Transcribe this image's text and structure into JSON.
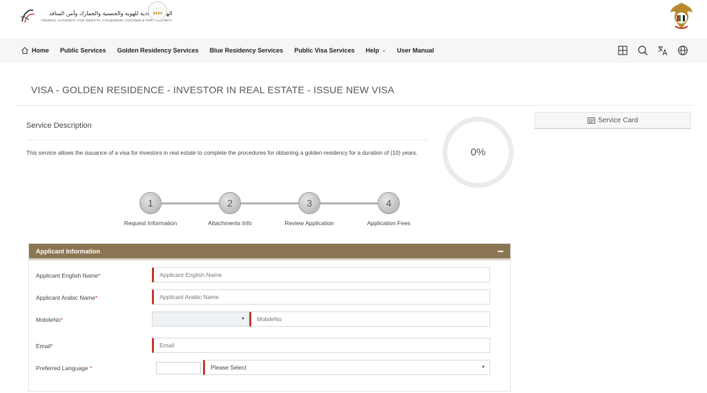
{
  "header": {
    "authority_ar": "الهيئة الاتحادية للهوية والجنسية والجمارك وأمن المنافذ",
    "authority_en": "FEDERAL AUTHORITY FOR IDENTITY, CITIZENSHIP, CUSTOMS & PORT SECURITY"
  },
  "nav": {
    "items": [
      {
        "label": "Home",
        "icon": "home-icon"
      },
      {
        "label": "Public Services"
      },
      {
        "label": "Golden Residency Services"
      },
      {
        "label": "Blue Residency Services"
      },
      {
        "label": "Public Visa Services"
      },
      {
        "label": "Help",
        "has_dropdown": true
      },
      {
        "label": "User Manual"
      }
    ],
    "icons": [
      "grid-icon",
      "search-icon",
      "translate-icon",
      "globe-icon"
    ]
  },
  "page": {
    "title": "VISA - GOLDEN RESIDENCE - INVESTOR IN REAL ESTATE - ISSUE NEW VISA"
  },
  "service": {
    "description_title": "Service Description",
    "description_text": "This service allows the issuance of a visa for investors in real estate to complete the procedures for obtaining a golden residency for a duration of (10) years.",
    "progress_label": "0%",
    "progress_value": 0,
    "service_card_label": "Service Card"
  },
  "steps": [
    {
      "number": "1",
      "label": "Request Information"
    },
    {
      "number": "2",
      "label": "Attachments Info"
    },
    {
      "number": "3",
      "label": "Review Application"
    },
    {
      "number": "4",
      "label": "Application Fees"
    }
  ],
  "applicant": {
    "panel_title": "Applicant Information",
    "fields": {
      "english_name": {
        "label": "Applicant English Name",
        "placeholder": "Applicant English Name",
        "value": ""
      },
      "arabic_name": {
        "label": "Applicant Arabic Name",
        "placeholder": "Applicant Arabic Name",
        "value": ""
      },
      "mobile": {
        "label": "MobileNo",
        "placeholder": "MobileNo",
        "value": "",
        "country_code": ""
      },
      "email": {
        "label": "Email",
        "placeholder": "Email",
        "value": ""
      },
      "preferred_language": {
        "label": "Preferred Language ",
        "selected": "Please Select"
      }
    },
    "required_mark": "*"
  },
  "colors": {
    "panel_header": "#8c7552",
    "required": "#c0392b",
    "nav_bg": "#f6f6f6"
  }
}
